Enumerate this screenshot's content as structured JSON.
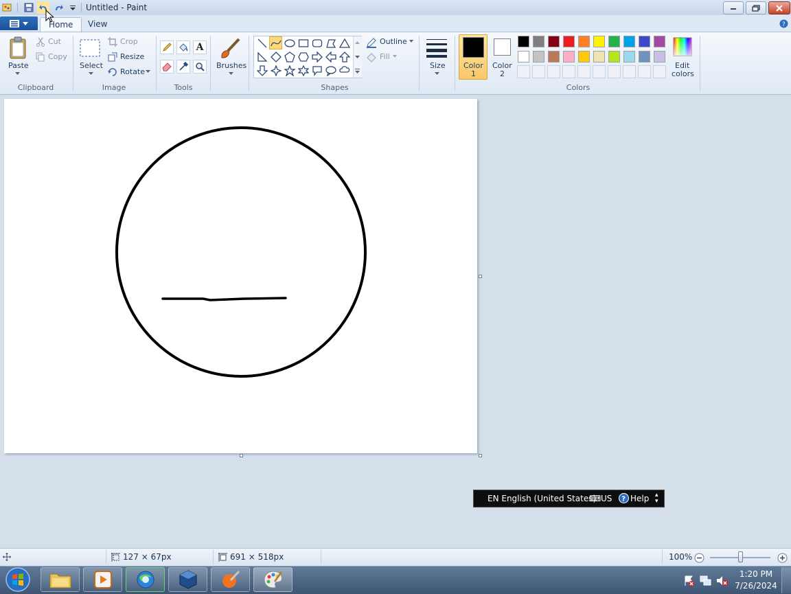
{
  "window": {
    "title": "Untitled - Paint"
  },
  "ribbon_tabs": {
    "home": "Home",
    "view": "View"
  },
  "clipboard": {
    "paste": "Paste",
    "cut": "Cut",
    "copy": "Copy",
    "group": "Clipboard"
  },
  "image": {
    "select": "Select",
    "crop": "Crop",
    "resize": "Resize",
    "rotate": "Rotate",
    "group": "Image"
  },
  "tools": {
    "group": "Tools",
    "items": [
      "pencil-icon",
      "fill-icon",
      "text-icon",
      "eraser-icon",
      "color-picker-icon",
      "magnifier-icon"
    ]
  },
  "brushes": {
    "label": "Brushes"
  },
  "shapes": {
    "group": "Shapes",
    "outline": "Outline",
    "fill": "Fill",
    "selected": "curve"
  },
  "size": {
    "label": "Size"
  },
  "colors": {
    "color1_line1": "Color",
    "color1_line2": "1",
    "color2_line1": "Color",
    "color2_line2": "2",
    "color1_value": "#000000",
    "color2_value": "#ffffff",
    "edit_line1": "Edit",
    "edit_line2": "colors",
    "group": "Colors",
    "palette_row1": [
      "#000000",
      "#7f7f7f",
      "#880015",
      "#ed1c24",
      "#ff7f27",
      "#fff200",
      "#22b14c",
      "#00a2e8",
      "#3f48cc",
      "#a349a4"
    ],
    "palette_row2": [
      "#ffffff",
      "#c3c3c3",
      "#b97a57",
      "#ffaec9",
      "#ffc90e",
      "#efe4b0",
      "#b5e61d",
      "#99d9ea",
      "#7092be",
      "#c8bfe7"
    ]
  },
  "status": {
    "selection_size": "127 × 67px",
    "canvas_size": "691 × 518px",
    "zoom": "100%"
  },
  "language_bar": {
    "language": "EN English (United States)",
    "layout": "US",
    "help": "Help"
  },
  "taskbar": {
    "time": "1:20 PM",
    "date": "7/26/2024"
  }
}
